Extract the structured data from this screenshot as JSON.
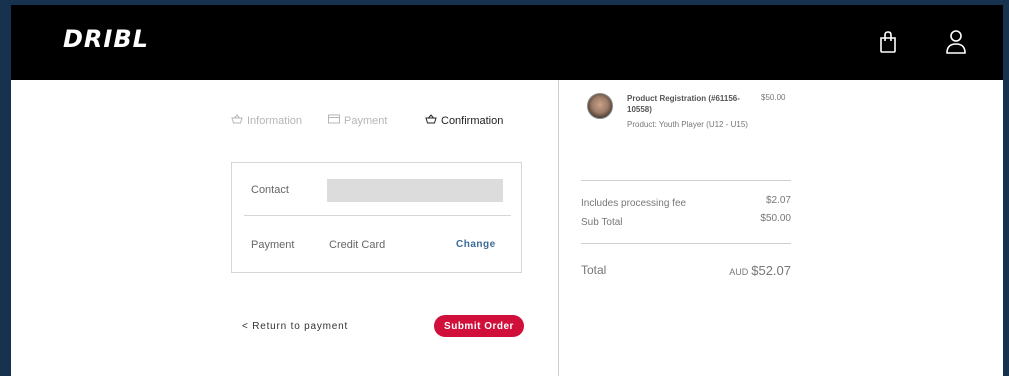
{
  "brand": {
    "logo_text": "DRIBL"
  },
  "header": {
    "cart_icon": "shopping-bag-icon",
    "account_icon": "user-icon"
  },
  "steps": [
    {
      "label": "Information",
      "icon": "basket-icon",
      "state": "done"
    },
    {
      "label": "Payment",
      "icon": "credit-card-icon",
      "state": "done"
    },
    {
      "label": "Confirmation",
      "icon": "basket-icon",
      "state": "active"
    }
  ],
  "review": {
    "contact_label": "Contact",
    "payment_label": "Payment",
    "payment_value": "Credit Card",
    "change_label": "Change"
  },
  "actions": {
    "return_label": "< Return to payment",
    "submit_label": "Submit Order"
  },
  "order": {
    "item": {
      "title": "Product Registration (#61156-10558)",
      "subtitle": "Product: Youth Player (U12 - U15)",
      "price": "$50.00"
    },
    "fee_label": "Includes processing fee",
    "fee_value": "$2.07",
    "subtotal_label": "Sub Total",
    "subtotal_value": "$50.00",
    "total_label": "Total",
    "total_currency": "AUD",
    "total_value": "$52.07"
  },
  "colors": {
    "accent": "#d0103a",
    "link": "#3d6b99",
    "header_bg": "#000000",
    "backdrop": "#16324f"
  }
}
